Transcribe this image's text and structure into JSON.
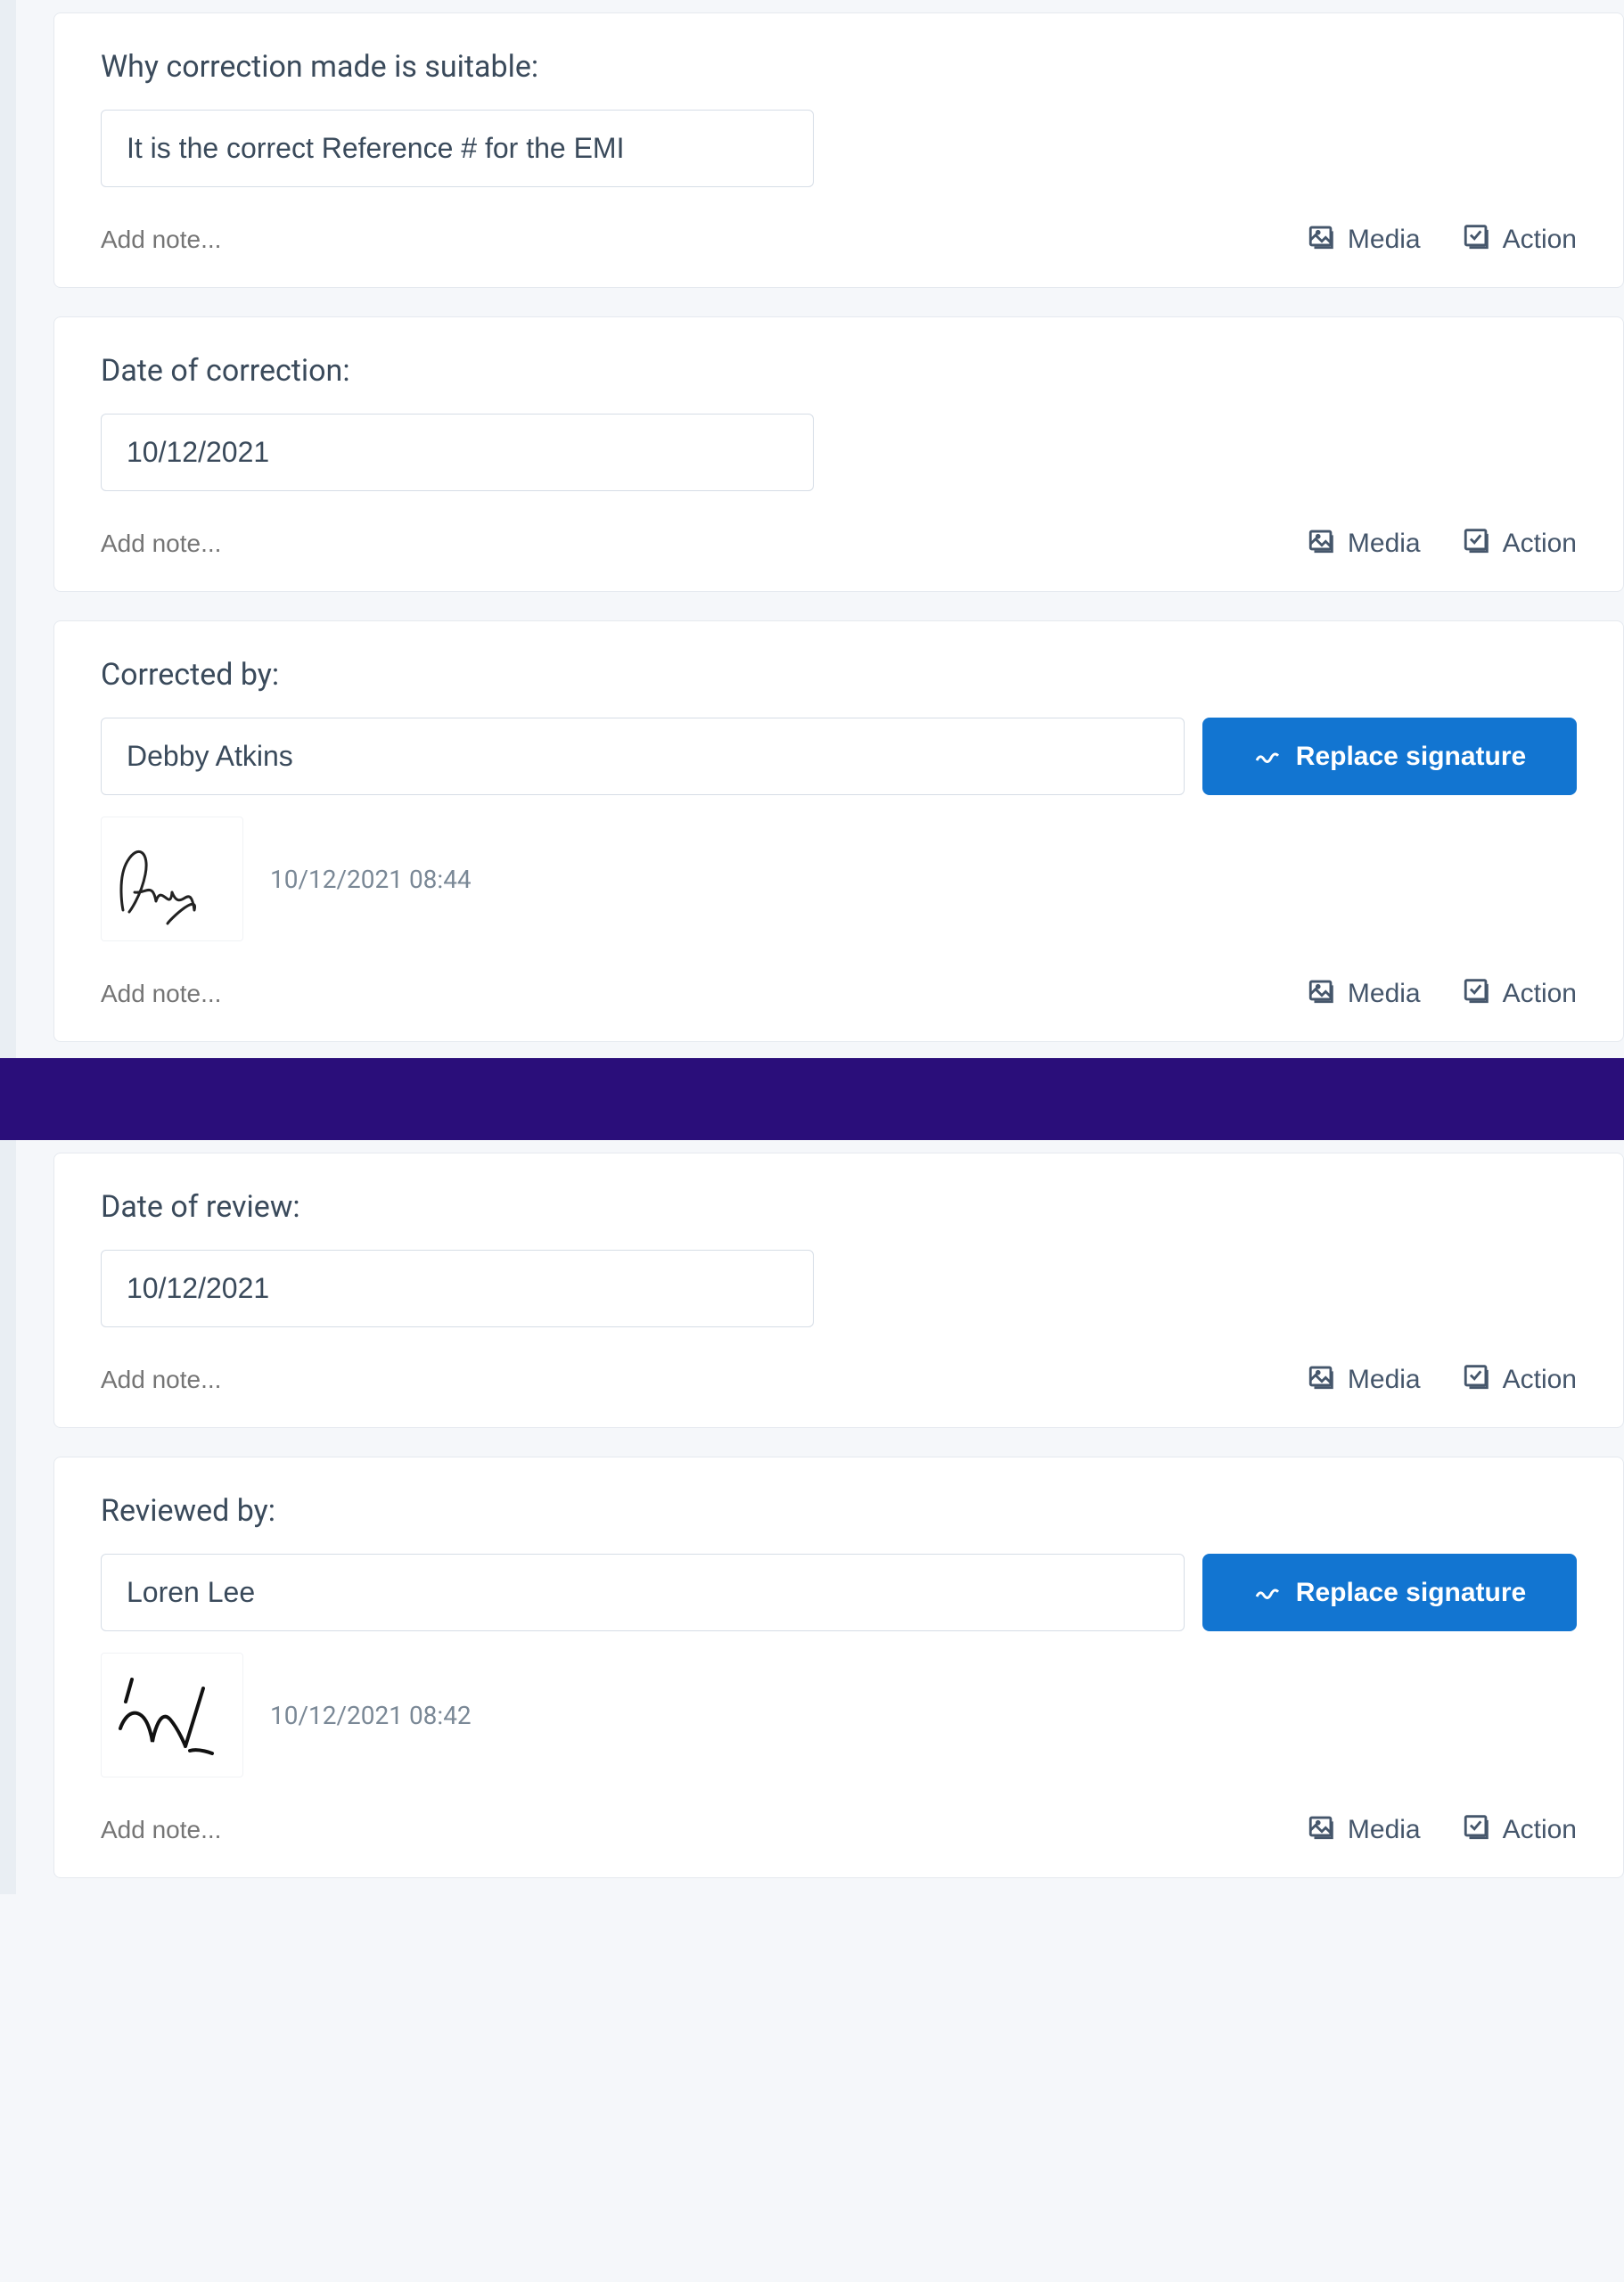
{
  "common": {
    "add_note_placeholder": "Add note...",
    "media_label": "Media",
    "action_label": "Action",
    "replace_signature_label": "Replace signature"
  },
  "cards": {
    "suitability": {
      "label": "Why correction made is suitable:",
      "value": "It is the correct Reference # for the EMI"
    },
    "date_correction": {
      "label": "Date of correction:",
      "value": "10/12/2021"
    },
    "corrected_by": {
      "label": "Corrected by:",
      "name": "Debby Atkins",
      "signature_timestamp": "10/12/2021 08:44"
    },
    "date_review": {
      "label": "Date of review:",
      "value": "10/12/2021"
    },
    "reviewed_by": {
      "label": "Reviewed by:",
      "name": "Loren Lee",
      "signature_timestamp": "10/12/2021 08:42"
    }
  }
}
